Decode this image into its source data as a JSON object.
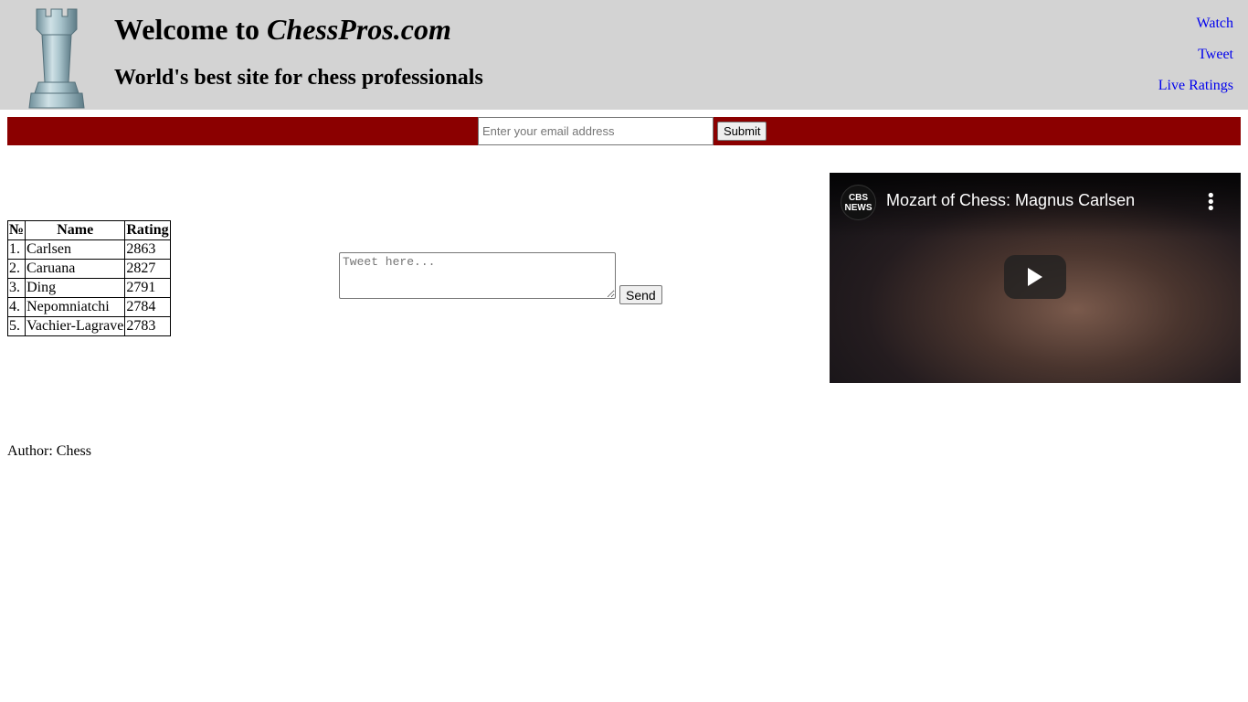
{
  "header": {
    "title_prefix": "Welcome to ",
    "title_site": "ChessPros.com",
    "subtitle": "World's best site for chess professionals",
    "logo_icon": "chess-rook-icon",
    "background_color": "#d3d3d3"
  },
  "nav": {
    "links": [
      {
        "label": "Watch"
      },
      {
        "label": "Tweet"
      },
      {
        "label": "Live Ratings"
      }
    ],
    "link_color": "#0000ee"
  },
  "subscribe": {
    "email_placeholder": "Enter your email address",
    "submit_label": "Submit",
    "bar_color": "#8b0000"
  },
  "ratings": {
    "headers": [
      "№",
      "Name",
      "Rating"
    ],
    "rows": [
      {
        "num": "1.",
        "name": "Carlsen",
        "rating": "2863"
      },
      {
        "num": "2.",
        "name": "Caruana",
        "rating": "2827"
      },
      {
        "num": "3.",
        "name": "Ding",
        "rating": "2791"
      },
      {
        "num": "4.",
        "name": "Nepomniatchi",
        "rating": "2784"
      },
      {
        "num": "5.",
        "name": "Vachier-Lagrave",
        "rating": "2783"
      }
    ]
  },
  "tweet": {
    "placeholder": "Tweet here...",
    "send_label": "Send"
  },
  "video": {
    "channel_label": "CBS NEWS",
    "title": "Mozart of Chess: Magnus Carlsen",
    "play_icon": "play-icon",
    "menu_icon": "more-vertical-icon"
  },
  "footer": {
    "author": "Author: Chess"
  }
}
